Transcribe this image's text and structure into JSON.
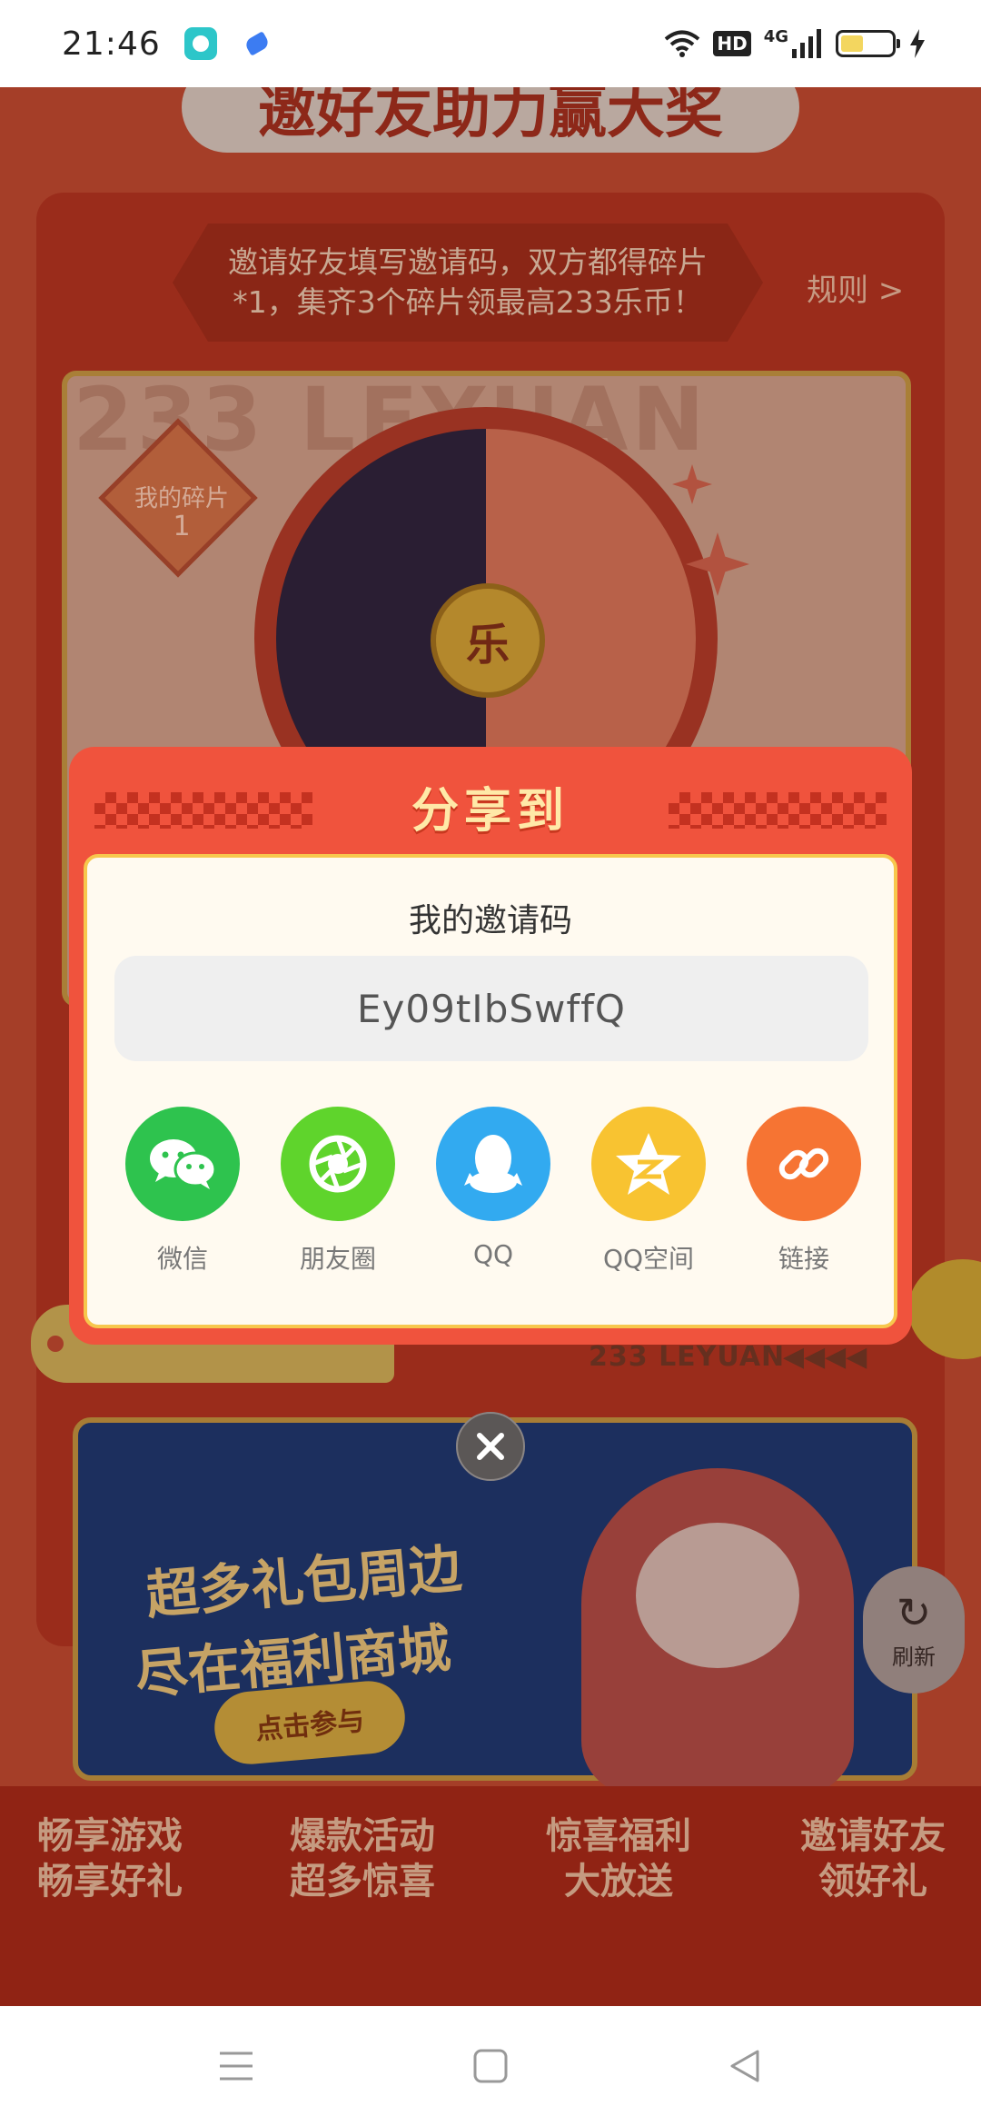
{
  "status_bar": {
    "time": "21:46",
    "hd": "HD",
    "network": "4G",
    "icons": [
      "app-notification-icon",
      "app-cloud-icon",
      "wifi-icon",
      "signal-icon",
      "battery-icon",
      "charging-icon"
    ]
  },
  "background": {
    "page_title": "邀好友助力赢大奖",
    "rule_text_line1": "邀请好友填写邀请码，双方都得碎片",
    "rule_text_line2": "*1，集齐3个碎片领最高233乐币！",
    "rule_link": "规则 >",
    "watermark": "233 LEYUAN",
    "fragment_label": "我的碎片",
    "fragment_count": "1",
    "wheel_center": "乐",
    "brand_line": "233 LEYUAN",
    "brand_arrows": "◀◀◀◀",
    "promo_line1": "超多礼包周边",
    "promo_line2": "尽在福利商城",
    "promo_button": "点击参与",
    "refresh_label": "刷新",
    "features": [
      {
        "line1": "畅享游戏",
        "line2": "畅享好礼"
      },
      {
        "line1": "爆款活动",
        "line2": "超多惊喜"
      },
      {
        "line1": "惊喜福利",
        "line2": "大放送"
      },
      {
        "line1": "邀请好友",
        "line2": "领好礼"
      }
    ]
  },
  "share_modal": {
    "title": "分享到",
    "invite_label": "我的邀请码",
    "invite_code": "Ey09tIbSwffQ",
    "targets": [
      {
        "label": "微信",
        "icon": "wechat-icon",
        "color": "#2ec34e"
      },
      {
        "label": "朋友圈",
        "icon": "moments-icon",
        "color": "#5fd42c"
      },
      {
        "label": "QQ",
        "icon": "qq-icon",
        "color": "#32aaf0"
      },
      {
        "label": "QQ空间",
        "icon": "qzone-icon",
        "color": "#f8c331"
      },
      {
        "label": "链接",
        "icon": "link-icon",
        "color": "#f67433"
      }
    ]
  },
  "navigation": {
    "icons": [
      "menu-icon",
      "home-icon",
      "back-icon"
    ]
  },
  "colors": {
    "modal_bg": "#f0533d",
    "modal_title": "#ffe9a8",
    "inner_border": "#f7c74d"
  }
}
